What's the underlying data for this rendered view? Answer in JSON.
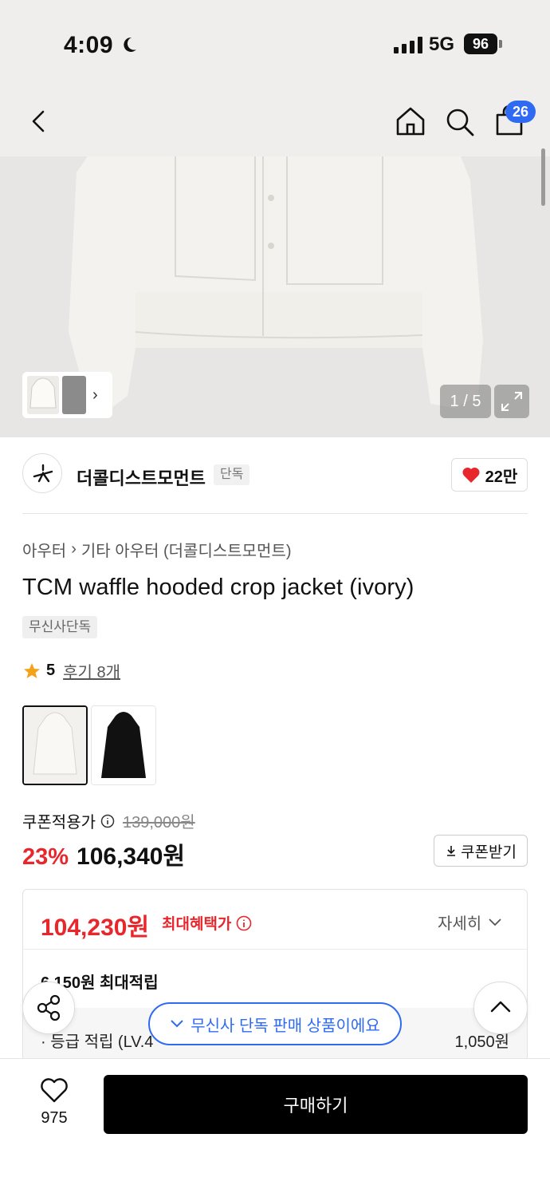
{
  "status_bar": {
    "time": "4:09",
    "network": "5G",
    "battery": "96"
  },
  "nav": {
    "cart_count": "26"
  },
  "gallery": {
    "counter": "1 / 5"
  },
  "brand": {
    "name": "더콜디스트모먼트",
    "tag": "단독",
    "likes": "22만"
  },
  "breadcrumb": {
    "category": "아우터",
    "subcategory": "기타 아우터 (더콜디스트모먼트)"
  },
  "product": {
    "title": "TCM waffle hooded crop jacket (ivory)",
    "tag": "무신사단독",
    "rating": "5",
    "reviews": "후기 8개"
  },
  "pricing": {
    "coupon_label": "쿠폰적용가",
    "original_price": "139,000원",
    "discount": "23%",
    "price": "106,340원",
    "coupon_button": "쿠폰받기"
  },
  "benefit": {
    "max_price": "104,230원",
    "max_label": "최대혜택가",
    "detail": "자세히",
    "points_title": "6,150원 최대적립",
    "points_row_label": "· 등급 적립 (LV.4",
    "points_row_value": "1,050원"
  },
  "toast": {
    "text": "무신사 단독 판매 상품이에요"
  },
  "bottom": {
    "wish_count": "975",
    "buy_label": "구매하기"
  },
  "colors": {
    "accent_red": "#e8272d",
    "accent_blue": "#2f6bf2"
  }
}
